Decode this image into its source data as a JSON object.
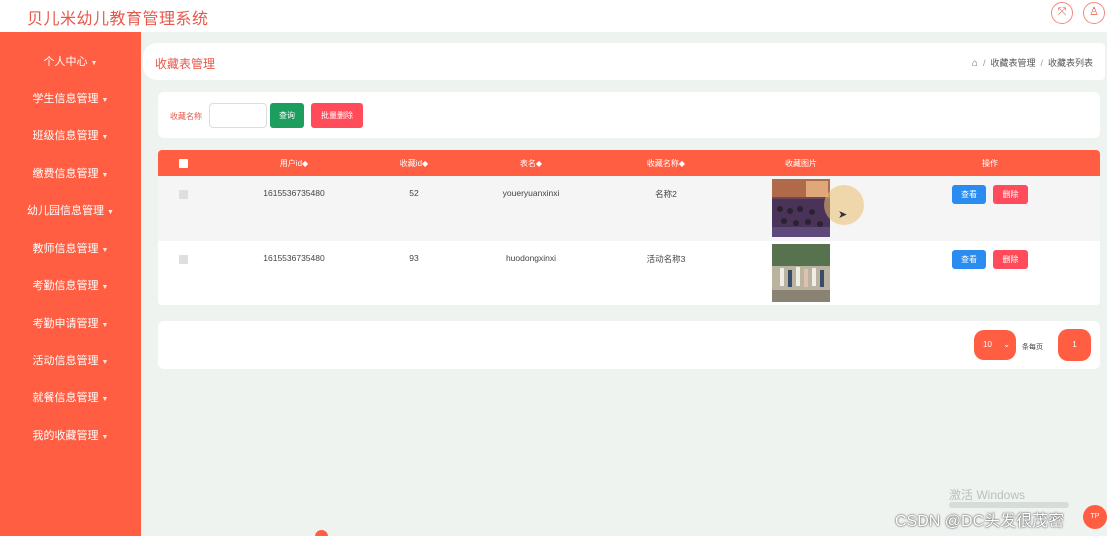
{
  "app": {
    "title": "贝儿米幼儿教育管理系统"
  },
  "top_icons": [
    {
      "name": "fullscreen-icon",
      "glyph": "⤧"
    },
    {
      "name": "user-icon",
      "glyph": "♙"
    }
  ],
  "sidebar": {
    "items": [
      {
        "label": "个人中心"
      },
      {
        "label": "学生信息管理"
      },
      {
        "label": "班级信息管理"
      },
      {
        "label": "缴费信息管理"
      },
      {
        "label": "幼儿园信息管理"
      },
      {
        "label": "教师信息管理"
      },
      {
        "label": "考勤信息管理"
      },
      {
        "label": "考勤申请管理"
      },
      {
        "label": "活动信息管理"
      },
      {
        "label": "就餐信息管理"
      },
      {
        "label": "我的收藏管理"
      }
    ]
  },
  "header": {
    "title": "收藏表管理",
    "breadcrumb": [
      "收藏表管理",
      "收藏表列表"
    ]
  },
  "search": {
    "label": "收藏名称",
    "value": "",
    "query_label": "查询",
    "batch_delete_label": "批量删除"
  },
  "table": {
    "columns": [
      "用户id◆",
      "收藏id◆",
      "表名◆",
      "收藏名称◆",
      "收藏图片",
      "操作"
    ],
    "rows": [
      {
        "user_id": "1615536735480",
        "fav_id": "52",
        "table_name": "youeryuanxinxi",
        "fav_name": "名称2",
        "view": "查看",
        "delete": "删除"
      },
      {
        "user_id": "1615536735480",
        "fav_id": "93",
        "table_name": "huodongxinxi",
        "fav_name": "活动名称3",
        "view": "查看",
        "delete": "删除"
      }
    ]
  },
  "pagination": {
    "page_size": "10",
    "per_page_label": "条每页",
    "current_page": "1"
  },
  "overlay": {
    "windows_activate": "激活 Windows",
    "watermark": "CSDN @DC头发很茂密",
    "float_button": "TP"
  },
  "colors": {
    "brand": "#ff5e42",
    "title": "#e8584a",
    "query_button": "#1e9e5e",
    "delete_button": "#ff4b5a",
    "view_button": "#2a8cf0"
  }
}
